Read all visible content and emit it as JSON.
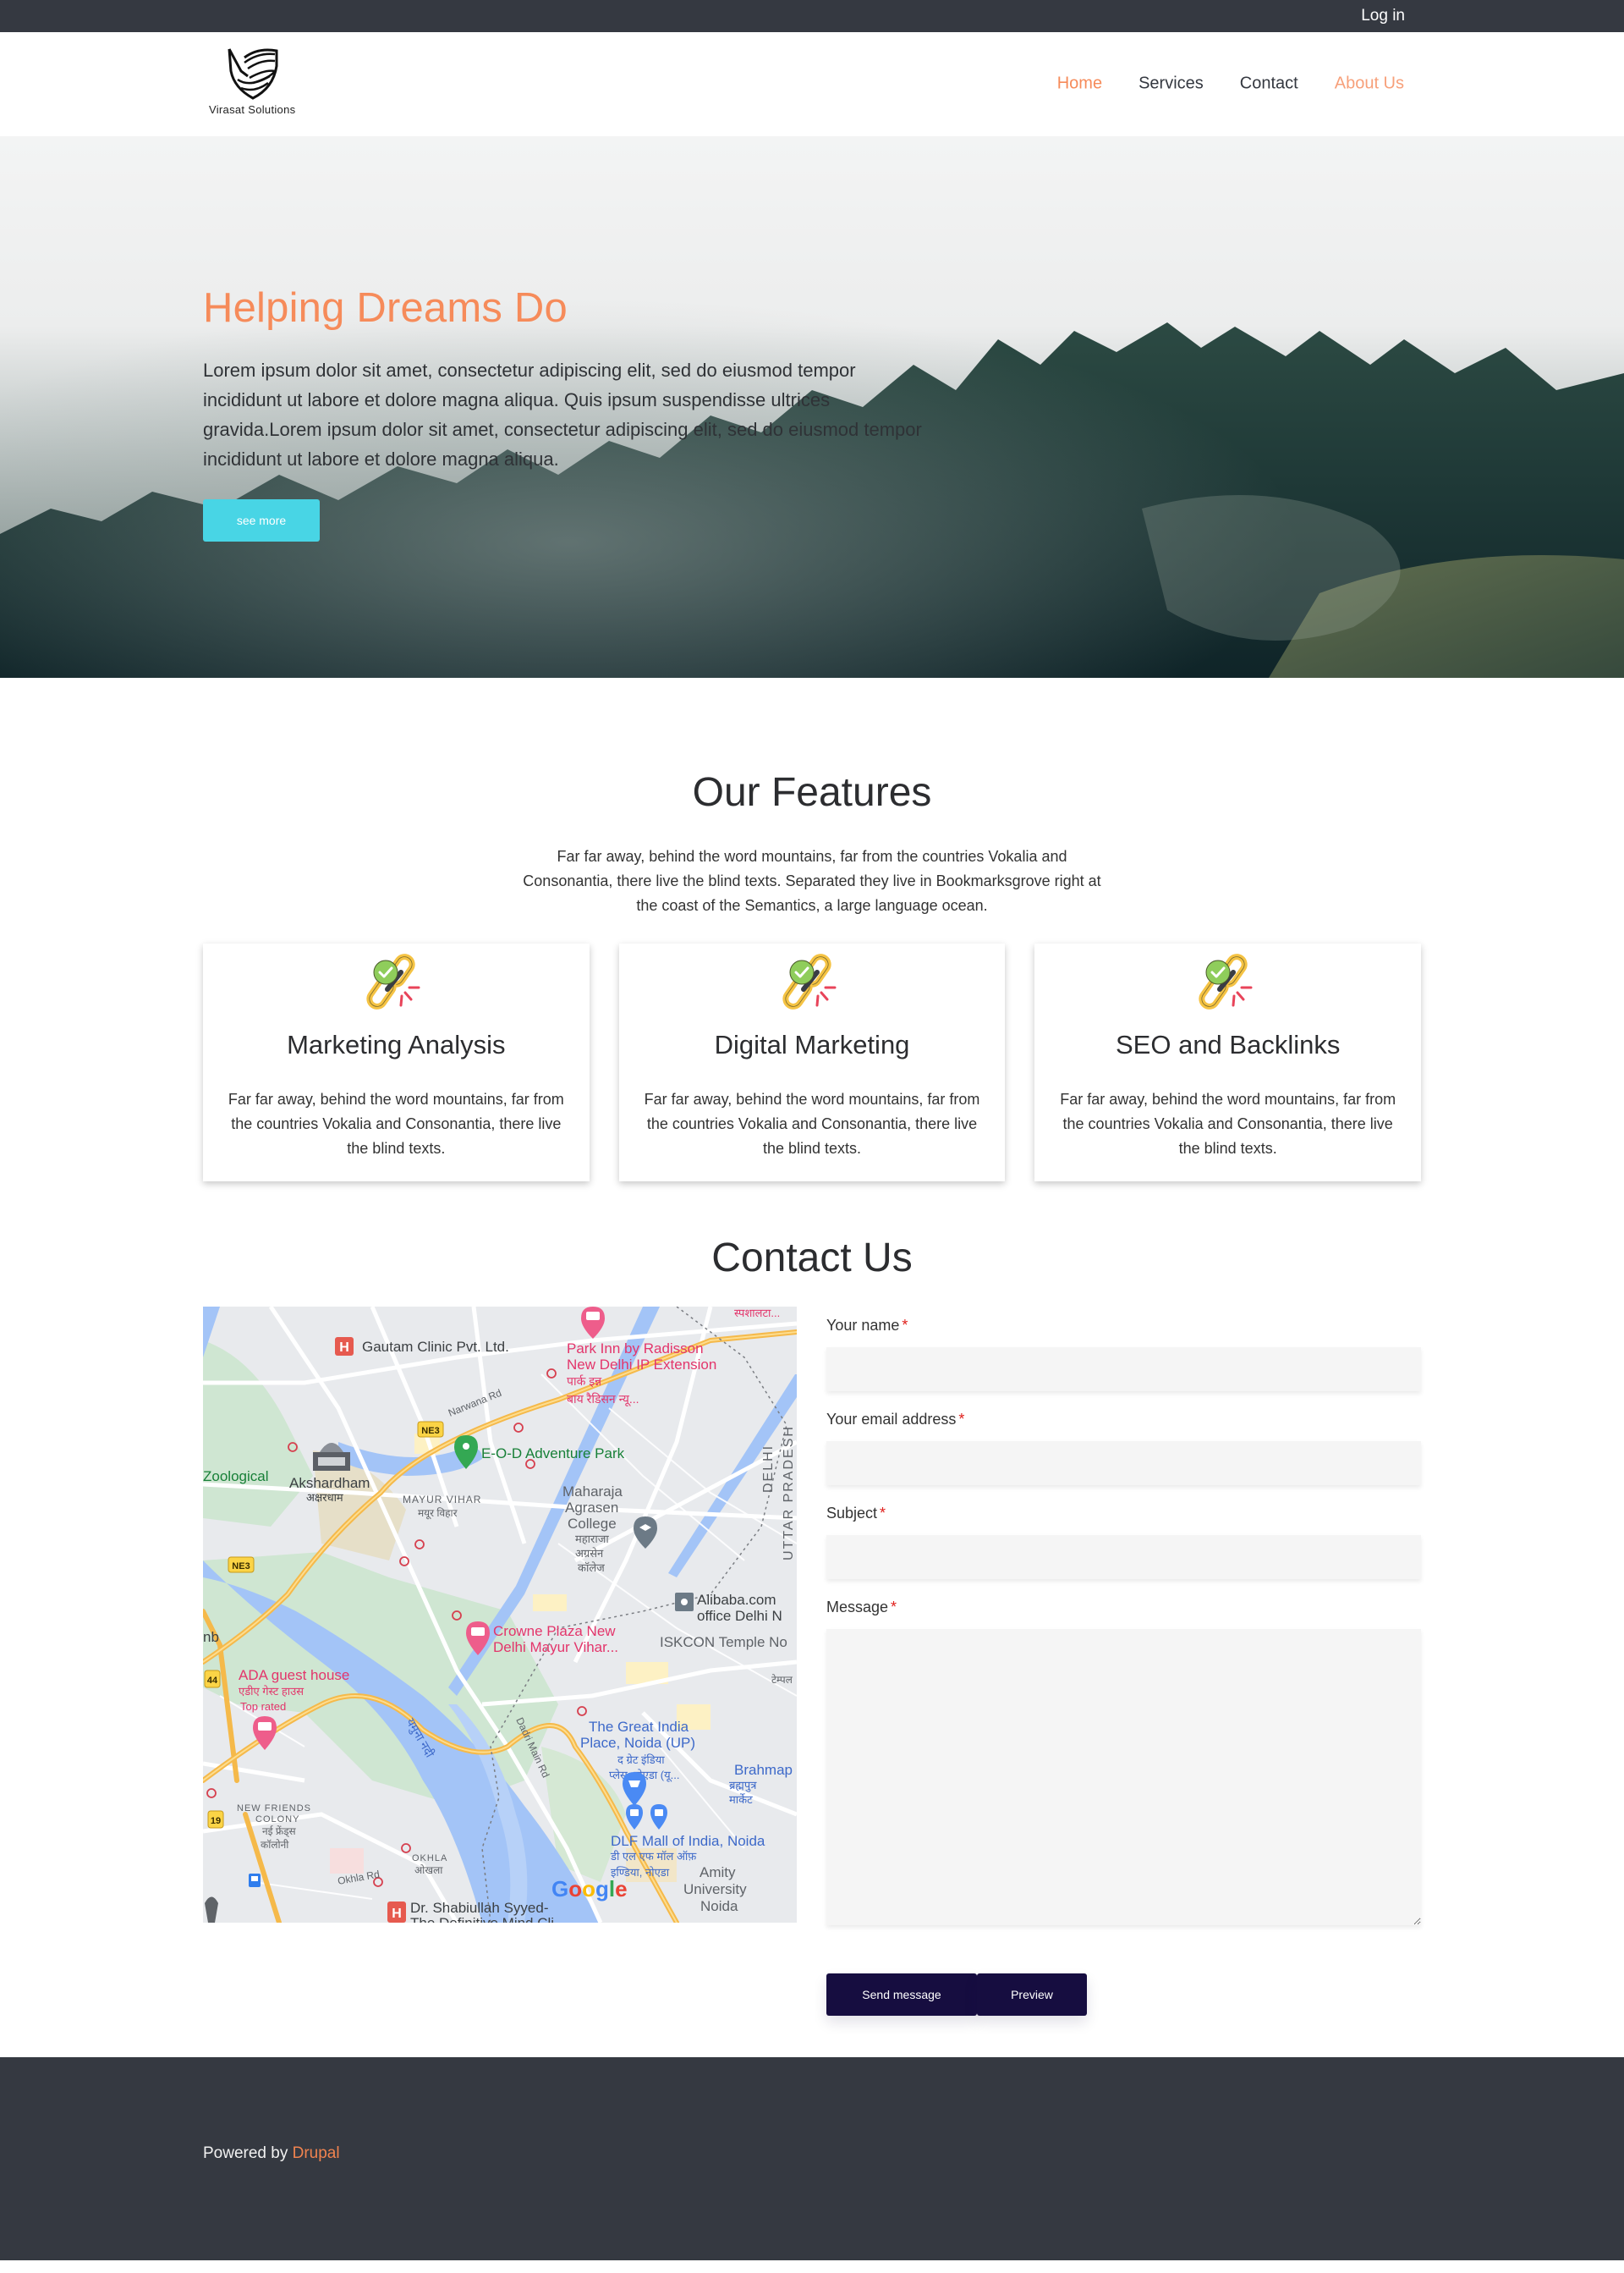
{
  "topbar": {
    "login_label": "Log in"
  },
  "header": {
    "logo_text": "Virasat Solutions",
    "nav": [
      {
        "label": "Home",
        "state": "active"
      },
      {
        "label": "Services",
        "state": "normal"
      },
      {
        "label": "Contact",
        "state": "normal"
      },
      {
        "label": "About Us",
        "state": "highlight"
      }
    ]
  },
  "hero": {
    "title": "Helping Dreams Do",
    "text": "Lorem ipsum dolor sit amet, consectetur adipiscing elit, sed do eiusmod tempor incididunt ut labore et dolore magna aliqua. Quis ipsum suspendisse ultrices gravida.Lorem ipsum dolor sit amet, consectetur adipiscing elit, sed do eiusmod tempor incididunt ut labore et dolore magna aliqua.",
    "button_label": "see more"
  },
  "features": {
    "title": "Our Features",
    "intro": "Far far away, behind the word mountains, far from the countries Vokalia and Consonantia, there live the blind texts. Separated they live in Bookmarksgrove right at the coast of the Semantics, a large language ocean.",
    "cards": [
      {
        "icon": "link-check-icon",
        "title": "Marketing Analysis",
        "text": "Far far away, behind the word mountains, far from the countries Vokalia and Consonantia, there live the blind texts."
      },
      {
        "icon": "link-check-icon",
        "title": "Digital Marketing",
        "text": "Far far away, behind the word mountains, far from the countries Vokalia and Consonantia, there live the blind texts."
      },
      {
        "icon": "link-check-icon",
        "title": "SEO and Backlinks",
        "text": "Far far away, behind the word mountains, far from the countries Vokalia and Consonantia, there live the blind texts."
      }
    ]
  },
  "contact": {
    "title": "Contact Us",
    "map": {
      "labels": {
        "gautam": "Gautam Clinic Pvt. Ltd.",
        "park_inn_1": "Park Inn by Radisson",
        "park_inn_2": "New Delhi IP Extension",
        "park_inn_hi_1": "पार्क इन्न",
        "park_inn_hi_2": "बाय रैडिसन न्यू...",
        "top_hi": "स्पशालटा...",
        "narwana": "Narwana Rd",
        "ne3": "NE3",
        "eod": "E-O-D Adventure Park",
        "zoological": "Zoological",
        "akshardham": "Akshardham",
        "akshardham_hi": "अक्षरधाम",
        "mayur_vihar": "MAYUR VIHAR",
        "mayur_vihar_hi": "मयूर विहार",
        "maharaja_1": "Maharaja",
        "maharaja_2": "Agrasen",
        "maharaja_3": "College",
        "maharaja_hi_1": "महाराजा",
        "maharaja_hi_2": "अग्रसेन",
        "maharaja_hi_3": "कॉलेज",
        "delhi": "DELHI",
        "up": "UTTAR PRADESH",
        "alibaba_1": "Alibaba.com",
        "alibaba_2": "office Delhi N",
        "crowne_1": "Crowne Plaza New",
        "crowne_2": "Delhi Mayur Vihar...",
        "iskcon": "ISKCON Temple No",
        "iskcon_hi": "टेम्पल",
        "ada_1": "ADA guest house",
        "ada_hi": "एडीए गेस्ट हाउस",
        "ada_rated": "Top rated",
        "hw44": "44",
        "hw19": "19",
        "yamuna": "यमुना नदी",
        "dadri": "Dadri Main Rd",
        "gip_1": "The Great India",
        "gip_2": "Place, Noida (UP)",
        "gip_hi_1": "द ग्रेट इंडिया",
        "gip_hi_2": "प्लेस, नोएडा (यू...",
        "brahma_1": "Brahmap",
        "brahma_hi_1": "ब्रह्मपुत्र",
        "brahma_hi_2": "मार्केट",
        "nfc_1": "NEW FRIENDS",
        "nfc_2": "COLONY",
        "nfc_hi_1": "नई फ्रेंड्स",
        "nfc_hi_2": "कॉलोनी",
        "okhla": "OKHLA",
        "okhla_hi": "ओखला",
        "okhla_rd": "Okhla Rd",
        "dlf_1": "DLF Mall of India, Noida",
        "dlf_hi_1": "डी एल एफ मॉल ऑफ़",
        "dlf_hi_2": "इण्डिया, नोएडा",
        "amity_1": "Amity",
        "amity_2": "University",
        "amity_3": "Noida",
        "shabi_1": "Dr. Shabiullah Syyed-",
        "shabi_2": "The Definitive Mind Cli...",
        "nb": "nb",
        "google": "Google"
      }
    },
    "form": {
      "fields": [
        {
          "label": "Your name",
          "required_mark": "*",
          "value": ""
        },
        {
          "label": "Your email address",
          "required_mark": "*",
          "value": ""
        },
        {
          "label": "Subject",
          "required_mark": "*",
          "value": ""
        },
        {
          "label": "Message",
          "required_mark": "*",
          "value": ""
        }
      ],
      "send_label": "Send message",
      "preview_label": "Preview"
    }
  },
  "footer": {
    "powered_text": "Powered by",
    "powered_link": "Drupal"
  },
  "colors": {
    "accent": "#f68b5a",
    "button_cyan": "#48d5e5",
    "button_dark": "#160d40",
    "dark_bar": "#353941"
  }
}
